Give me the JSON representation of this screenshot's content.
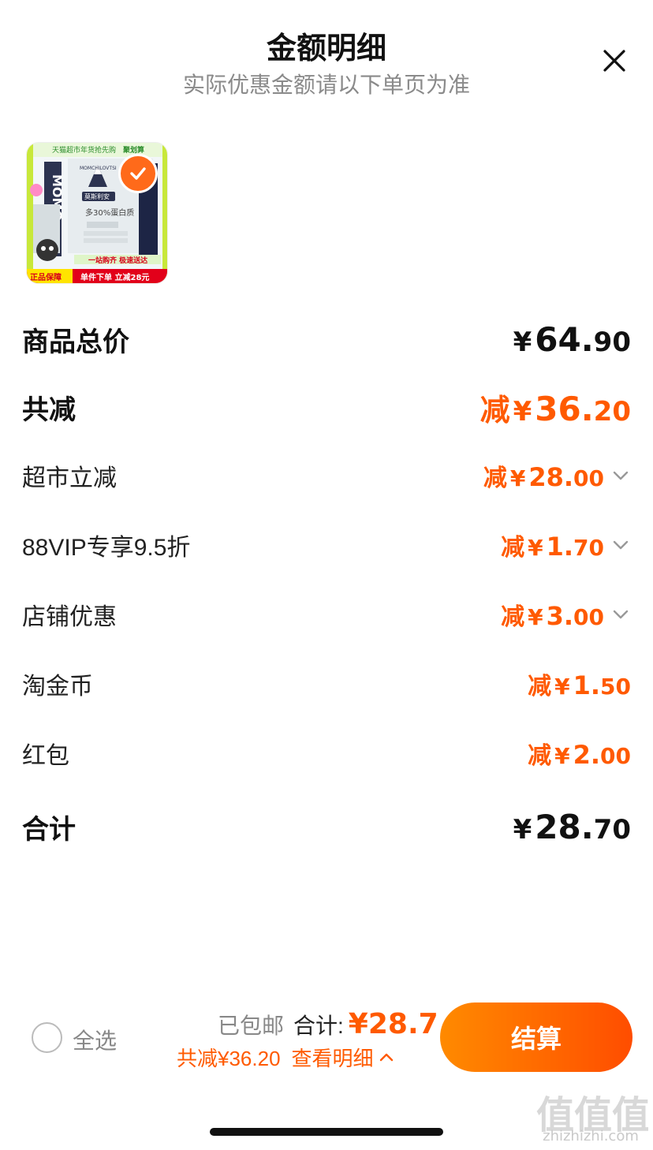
{
  "header": {
    "title": "金额明细",
    "subtitle": "实际优惠金额请以下单页为准"
  },
  "product": {
    "banner_top": "天猫超市年货抢先购",
    "banner_top_brand": "聚划算",
    "brand_name": "莫斯利安",
    "brand_logo_text": "MOMCHILOVTSI",
    "feature": "多30%蛋白质",
    "promo_line": "一站购齐 极速送达",
    "guarantee": "正品保障",
    "bottom_promo": "单件下单 立减28元"
  },
  "rows": [
    {
      "label": "商品总价",
      "prefix": "",
      "yen": "¥",
      "int": "64.",
      "dec": "90",
      "style": "total-black",
      "chevron": false
    },
    {
      "label": "共减",
      "prefix": "减",
      "yen": "¥",
      "int": "36.",
      "dec": "20",
      "style": "total-orange",
      "chevron": false
    },
    {
      "label": "超市立减",
      "prefix": "减",
      "yen": "¥",
      "int": "28.",
      "dec": "00",
      "style": "item",
      "chevron": true
    },
    {
      "label": "88VIP专享9.5折",
      "prefix": "减",
      "yen": "¥",
      "int": "1.",
      "dec": "70",
      "style": "item",
      "chevron": true
    },
    {
      "label": "店铺优惠",
      "prefix": "减",
      "yen": "¥",
      "int": "3.",
      "dec": "00",
      "style": "item",
      "chevron": true
    },
    {
      "label": "淘金币",
      "prefix": "减",
      "yen": "¥",
      "int": "1.",
      "dec": "50",
      "style": "item",
      "chevron": false
    },
    {
      "label": "红包",
      "prefix": "减",
      "yen": "¥",
      "int": "2.",
      "dec": "00",
      "style": "item",
      "chevron": false
    },
    {
      "label": "合计",
      "prefix": "",
      "yen": "¥",
      "int": "28.",
      "dec": "70",
      "style": "total-black",
      "chevron": false
    }
  ],
  "footer": {
    "select_all": "全选",
    "shipping": "已包邮",
    "total_label": "合计:",
    "total_value": "¥28.7",
    "saved_text": "共减¥36.20",
    "details_link": "查看明细",
    "checkout": "结算"
  },
  "watermark": {
    "text": "zhizhizhi.com",
    "logo": "值值值"
  },
  "colors": {
    "accent": "#ff5a00",
    "button_start": "#ff8a00",
    "button_end": "#ff4d00",
    "text": "#111111",
    "muted": "#8a8a8a"
  }
}
